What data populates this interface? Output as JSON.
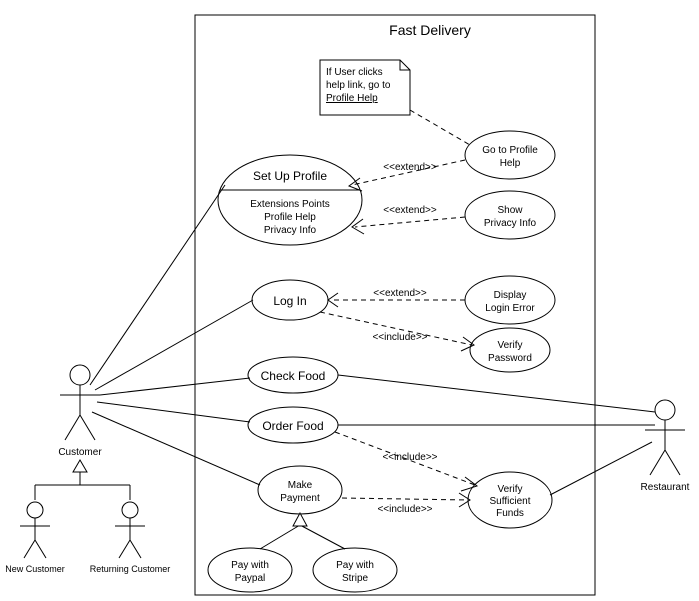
{
  "system": {
    "title": "Fast Delivery"
  },
  "actors": {
    "customer": "Customer",
    "new_customer": "New Customer",
    "returning_customer": "Returning Customer",
    "restaurant": "Restaurant"
  },
  "usecases": {
    "set_up_profile": "Set Up Profile",
    "set_up_profile_ext_header": "Extensions Points",
    "set_up_profile_ext1": "Profile Help",
    "set_up_profile_ext2": "Privacy Info",
    "go_to_profile_help_l1": "Go to Profile",
    "go_to_profile_help_l2": "Help",
    "show_privacy_info_l1": "Show",
    "show_privacy_info_l2": "Privacy Info",
    "log_in": "Log In",
    "display_login_error_l1": "Display",
    "display_login_error_l2": "Login Error",
    "verify_password_l1": "Verify",
    "verify_password_l2": "Password",
    "check_food": "Check Food",
    "order_food": "Order Food",
    "make_payment_l1": "Make",
    "make_payment_l2": "Payment",
    "verify_funds_l1": "Verify",
    "verify_funds_l2": "Sufficient",
    "verify_funds_l3": "Funds",
    "pay_paypal_l1": "Pay with",
    "pay_paypal_l2": "Paypal",
    "pay_stripe_l1": "Pay with",
    "pay_stripe_l2": "Stripe"
  },
  "stereotypes": {
    "extend": "<<extend>>",
    "include": "<<include>>"
  },
  "note": {
    "l1": "If User clicks",
    "l2": "help link, go to",
    "l3": "Profile Help"
  },
  "chart_data": {
    "type": "uml-use-case",
    "system": "Fast Delivery",
    "actors": [
      {
        "id": "customer",
        "name": "Customer"
      },
      {
        "id": "new_customer",
        "name": "New Customer",
        "generalizes": "customer"
      },
      {
        "id": "returning_customer",
        "name": "Returning Customer",
        "generalizes": "customer"
      },
      {
        "id": "restaurant",
        "name": "Restaurant"
      }
    ],
    "use_cases": [
      {
        "id": "set_up_profile",
        "name": "Set Up Profile",
        "extension_points": [
          "Profile Help",
          "Privacy Info"
        ]
      },
      {
        "id": "go_to_profile_help",
        "name": "Go to Profile Help"
      },
      {
        "id": "show_privacy_info",
        "name": "Show Privacy Info"
      },
      {
        "id": "log_in",
        "name": "Log In"
      },
      {
        "id": "display_login_error",
        "name": "Display Login Error"
      },
      {
        "id": "verify_password",
        "name": "Verify Password"
      },
      {
        "id": "check_food",
        "name": "Check Food"
      },
      {
        "id": "order_food",
        "name": "Order Food"
      },
      {
        "id": "make_payment",
        "name": "Make Payment"
      },
      {
        "id": "verify_sufficient_funds",
        "name": "Verify Sufficient Funds"
      },
      {
        "id": "pay_with_paypal",
        "name": "Pay with Paypal",
        "generalizes": "make_payment"
      },
      {
        "id": "pay_with_stripe",
        "name": "Pay with Stripe",
        "generalizes": "make_payment"
      }
    ],
    "associations": [
      {
        "actor": "customer",
        "use_case": "set_up_profile"
      },
      {
        "actor": "customer",
        "use_case": "log_in"
      },
      {
        "actor": "customer",
        "use_case": "check_food"
      },
      {
        "actor": "customer",
        "use_case": "order_food"
      },
      {
        "actor": "customer",
        "use_case": "make_payment"
      },
      {
        "actor": "restaurant",
        "use_case": "check_food"
      },
      {
        "actor": "restaurant",
        "use_case": "order_food"
      },
      {
        "actor": "restaurant",
        "use_case": "verify_sufficient_funds"
      }
    ],
    "dependencies": [
      {
        "from": "go_to_profile_help",
        "to": "set_up_profile",
        "stereotype": "extend"
      },
      {
        "from": "show_privacy_info",
        "to": "set_up_profile",
        "stereotype": "extend"
      },
      {
        "from": "display_login_error",
        "to": "log_in",
        "stereotype": "extend"
      },
      {
        "from": "log_in",
        "to": "verify_password",
        "stereotype": "include"
      },
      {
        "from": "make_payment",
        "to": "verify_sufficient_funds",
        "stereotype": "include"
      },
      {
        "from": "order_food",
        "to": "verify_sufficient_funds",
        "stereotype": "include"
      }
    ],
    "notes": [
      {
        "text": "If User clicks help link, go to Profile Help",
        "attached_to": "go_to_profile_help"
      }
    ]
  }
}
